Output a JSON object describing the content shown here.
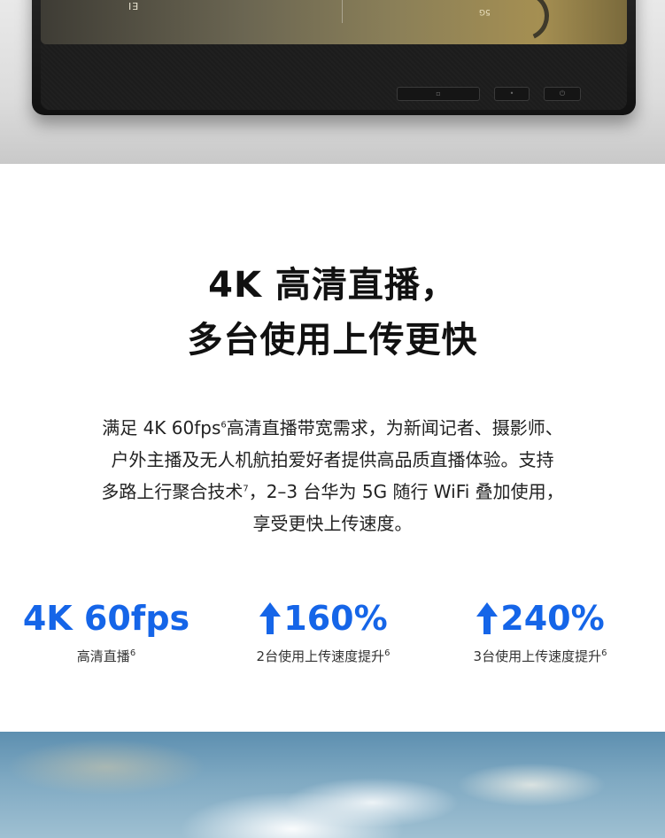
{
  "device": {
    "screen_brand": "EI",
    "screen_network": "5G"
  },
  "headline": {
    "line1": "4K 高清直播，",
    "line2": "多台使用上传更快"
  },
  "description": {
    "line1_a": "满足 4K 60fps",
    "line1_sup": "6",
    "line1_b": "高清直播带宽需求，为新闻记者、摄影师、",
    "line2": "户外主播及无人机航拍爱好者提供高品质直播体验。支持",
    "line3_a": "多路上行聚合技术",
    "line3_sup": "7",
    "line3_b": "，2–3 台华为 5G 随行 WiFi 叠加使用，",
    "line4": "享受更快上传速度。"
  },
  "stats": [
    {
      "value": "4K 60fps",
      "has_arrow": false,
      "caption": "高清直播",
      "sup": "6"
    },
    {
      "value": "160%",
      "has_arrow": true,
      "caption": "2台使用上传速度提升",
      "sup": "6"
    },
    {
      "value": "240%",
      "has_arrow": true,
      "caption": "3台使用上传速度提升",
      "sup": "6"
    }
  ],
  "colors": {
    "accent": "#1565e8",
    "text": "#111111"
  },
  "icons": {
    "stat_arrow": "arrow-up-icon"
  }
}
